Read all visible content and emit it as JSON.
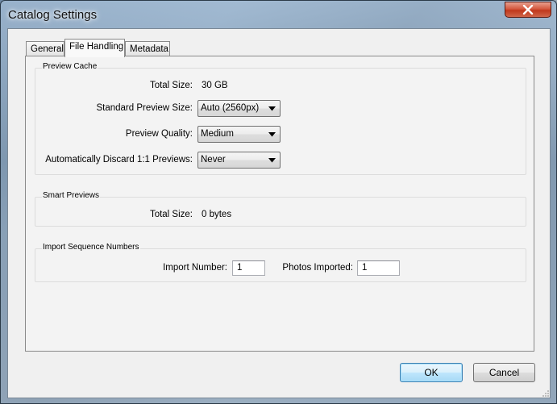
{
  "window": {
    "title": "Catalog Settings"
  },
  "tabs": [
    {
      "label": "General",
      "active": false
    },
    {
      "label": "File Handling",
      "active": true
    },
    {
      "label": "Metadata",
      "active": false
    }
  ],
  "preview_cache": {
    "title": "Preview Cache",
    "total_size_label": "Total Size:",
    "total_size_value": "30 GB",
    "standard_preview_size_label": "Standard Preview Size:",
    "standard_preview_size_value": "Auto (2560px)",
    "preview_quality_label": "Preview Quality:",
    "preview_quality_value": "Medium",
    "discard_label": "Automatically Discard 1:1 Previews:",
    "discard_value": "Never"
  },
  "smart_previews": {
    "title": "Smart Previews",
    "total_size_label": "Total Size:",
    "total_size_value": "0 bytes"
  },
  "import_sequence": {
    "title": "Import Sequence Numbers",
    "import_number_label": "Import Number:",
    "import_number_value": "1",
    "photos_imported_label": "Photos Imported:",
    "photos_imported_value": "1"
  },
  "buttons": {
    "ok": "OK",
    "cancel": "Cancel"
  },
  "icons": {
    "close": "close-icon",
    "dropdown": "chevron-down-icon"
  },
  "colors": {
    "close_button": "#c0381c",
    "default_button_border": "#3c7fb1",
    "dialog_background": "#f0f0f0"
  }
}
